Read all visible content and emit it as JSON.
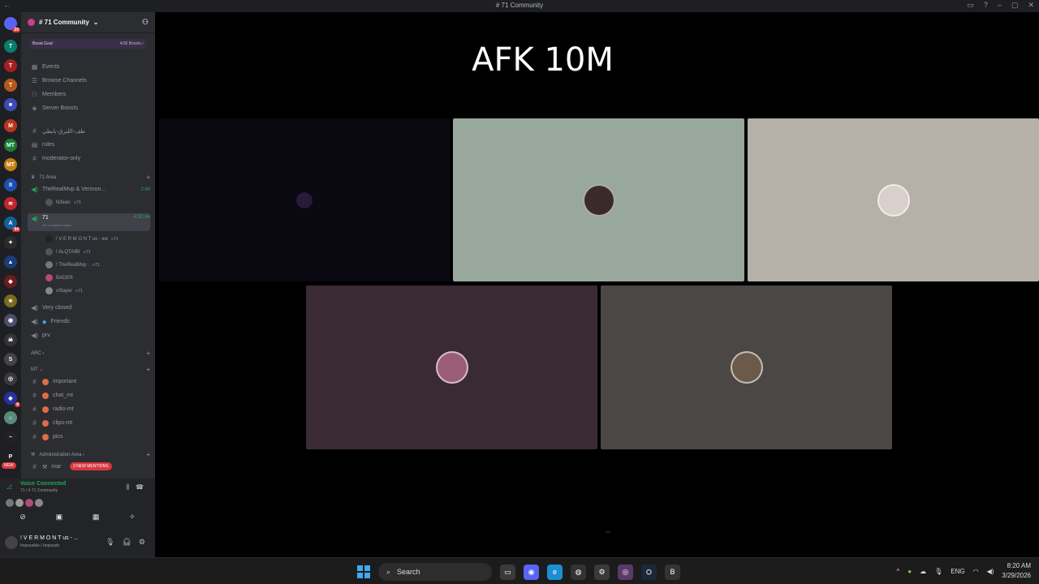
{
  "window": {
    "title": "# 71 Community",
    "back": "←",
    "controls": [
      "▭",
      "?",
      "–",
      "▢",
      "✕"
    ]
  },
  "rail": {
    "servers": [
      {
        "icon": "discord-home-icon",
        "label": "",
        "color": "#5865f2",
        "badge": "29"
      },
      {
        "icon": "server-icon",
        "label": "T",
        "color": "#0a7d6b",
        "badge": ""
      },
      {
        "icon": "server-icon",
        "label": "T",
        "color": "#a52020",
        "badge": ""
      },
      {
        "icon": "server-icon",
        "label": "T",
        "color": "#b5581d",
        "badge": ""
      },
      {
        "icon": "folder-icon",
        "label": "■",
        "color": "#3d4bb8",
        "badge": ""
      },
      {
        "icon": "server-icon",
        "label": "M",
        "color": "#b8361d",
        "badge": ""
      },
      {
        "icon": "server-icon",
        "label": "MT",
        "color": "#1a7e37",
        "badge": ""
      },
      {
        "icon": "server-icon",
        "label": "MT",
        "color": "#c47f12",
        "badge": ""
      },
      {
        "icon": "server-icon",
        "label": "II",
        "color": "#1e4fb0",
        "badge": ""
      },
      {
        "icon": "server-icon",
        "label": "≋",
        "color": "#c0262c",
        "badge": ""
      },
      {
        "icon": "server-icon",
        "label": "A",
        "color": "#155e9b",
        "badge": "94"
      },
      {
        "icon": "server-icon",
        "label": "✦",
        "color": "#2b2b2b",
        "badge": ""
      },
      {
        "icon": "server-icon",
        "label": "▲",
        "color": "#1b3c7a",
        "badge": ""
      },
      {
        "icon": "server-icon",
        "label": "◆",
        "color": "#6b1d1d",
        "badge": ""
      },
      {
        "icon": "server-icon",
        "label": "★",
        "color": "#7a6a1d",
        "badge": ""
      },
      {
        "icon": "server-icon",
        "label": "◉",
        "color": "#4d4d6b",
        "badge": ""
      },
      {
        "icon": "server-icon",
        "label": "☠",
        "color": "#333",
        "badge": ""
      },
      {
        "icon": "server-icon",
        "label": "S",
        "color": "#444",
        "badge": ""
      },
      {
        "icon": "server-icon",
        "label": "◎",
        "color": "#3a3a3a",
        "badge": ""
      },
      {
        "icon": "server-icon",
        "label": "◈",
        "color": "#2433a0",
        "badge": "8"
      },
      {
        "icon": "server-icon",
        "label": "⌂",
        "color": "#5a8a7a",
        "badge": ""
      },
      {
        "icon": "server-icon",
        "label": "~",
        "color": "#222",
        "badge": ""
      },
      {
        "icon": "server-icon",
        "label": "P",
        "color": "#1e1f22",
        "badge": ""
      }
    ],
    "new_badge": "NEW"
  },
  "sidebar": {
    "guild_name": "# 71 Community",
    "boost_goal": "Boost Goal",
    "boost_count": "4/36 Boosts ›",
    "menu": [
      {
        "icon": "calendar-icon",
        "label": "Events"
      },
      {
        "icon": "browse-channels-icon",
        "label": "Browse Channels"
      },
      {
        "icon": "members-icon",
        "label": "Members"
      },
      {
        "icon": "boost-icon",
        "label": "Server Boosts"
      }
    ],
    "channels_top": [
      {
        "icon": "hash-icon",
        "label": "طف-الليرق-بابطي"
      },
      {
        "icon": "rules-icon",
        "label": "rules"
      },
      {
        "icon": "hash-icon",
        "label": "moderator-only"
      }
    ],
    "cat_71": "71 Area",
    "voice_1": {
      "label": "TheRealMvp & Vermon...",
      "time": "2:46"
    },
    "voice_1_user": {
      "name": "N3ean",
      "tag": "ෆ71"
    },
    "voice_active": {
      "label": "71",
      "time": "4:30:44",
      "status": "Set a channel status"
    },
    "voice_users": [
      {
        "name": "! V E R M O N T us - ĸw",
        "tag": "ෆ71"
      },
      {
        "name": "! ALQTAIBI",
        "tag": "ෆ71"
      },
      {
        "name": "! TheRealMvp .",
        "tag": "ෆ71"
      },
      {
        "name": "BADER",
        "tag": ""
      },
      {
        "name": "vSlayer",
        "tag": "ෆ71"
      }
    ],
    "voice_more": [
      {
        "label": "Very closed"
      },
      {
        "label": "Friends"
      },
      {
        "label": "prv"
      }
    ],
    "cat_arc": "ARC ›",
    "cat_mt": "MT ⌄",
    "mt_channels": [
      {
        "label": "important"
      },
      {
        "label": "chat_mt"
      },
      {
        "label": "radio-mt"
      },
      {
        "label": "clips-mt"
      },
      {
        "label": "pics"
      }
    ],
    "cat_admin": "Administration Area ›",
    "admin_channel": "mar",
    "mentions": "3 NEW MENTIONS"
  },
  "voice_panel": {
    "status": "Voice Connected",
    "location": "71 / # 71 Community",
    "user_name": "! V E R M O N T us - ...",
    "user_sub": "Impossible / Impossib"
  },
  "stage": {
    "heading": "AFK 10M",
    "tiles": [
      {
        "user": "empty-tile",
        "color": "#0a0810",
        "avatar": "#2a1a3a"
      },
      {
        "user": "user-tile",
        "color": "#98a89c",
        "avatar": "#3a2a2a"
      },
      {
        "user": "user-tile",
        "color": "#b5b1a9",
        "avatar": "#d9d0cc"
      },
      {
        "user": "user-tile",
        "color": "#3a2a34",
        "avatar": "#9b5c7a"
      },
      {
        "user": "user-tile",
        "color": "#4a4744",
        "avatar": "#6b5a4a"
      }
    ]
  },
  "taskbar": {
    "search_label": "Search",
    "apps": [
      {
        "icon": "file-explorer-icon",
        "label": "▭",
        "color": "#3a3a3a"
      },
      {
        "icon": "discord-icon",
        "label": "◉",
        "color": "#5865f2"
      },
      {
        "icon": "edge-icon",
        "label": "e",
        "color": "#1b8fd1"
      },
      {
        "icon": "chrome-icon",
        "label": "◍",
        "color": "#333"
      },
      {
        "icon": "settings-icon",
        "label": "⚙",
        "color": "#3a3a3a"
      },
      {
        "icon": "obs-icon",
        "label": "◎",
        "color": "#5a3a6a"
      },
      {
        "icon": "steam-icon",
        "label": "⛭",
        "color": "#1b2838"
      },
      {
        "icon": "app-icon",
        "label": "B",
        "color": "#333"
      }
    ],
    "lang": "ENG",
    "time": "8:20 AM",
    "date": "3/29/2026"
  }
}
